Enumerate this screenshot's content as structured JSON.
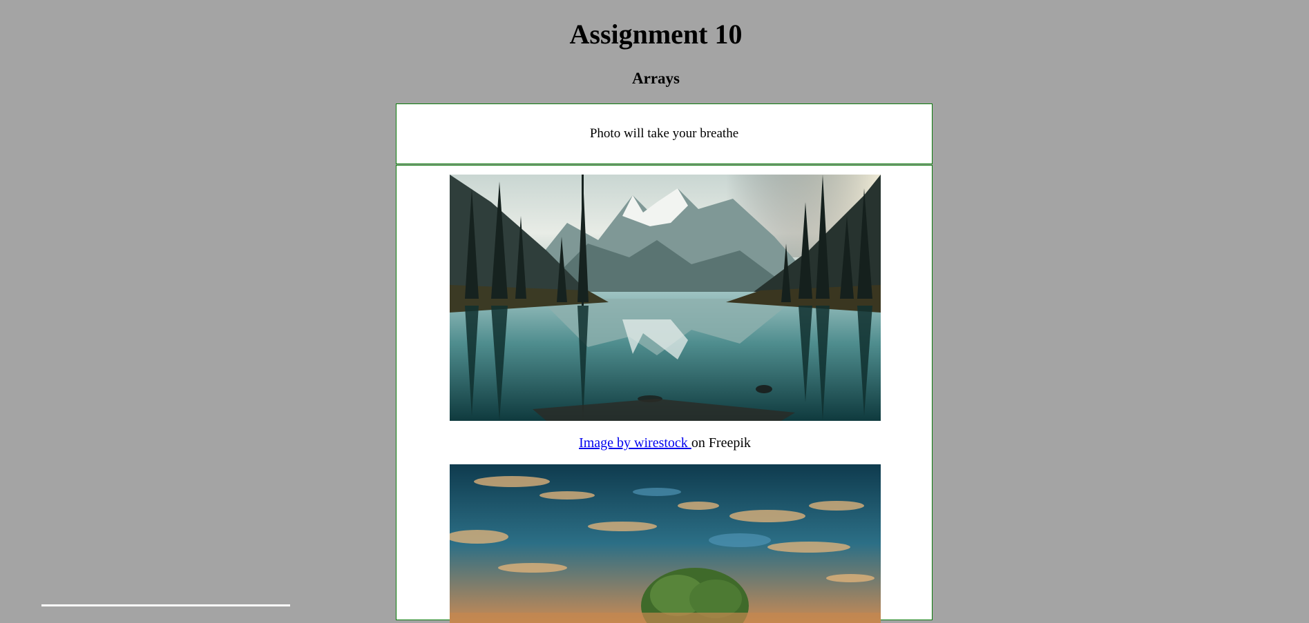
{
  "page": {
    "title": "Assignment 10",
    "subtitle": "Arrays"
  },
  "header_box": {
    "text": "Photo will take your breathe"
  },
  "gallery": {
    "items": [
      {
        "image_name": "mountain-lake-reflection-image",
        "caption_link": "Image by wirestock ",
        "caption_suffix": "on Freepik"
      },
      {
        "image_name": "sunset-tree-sky-image"
      }
    ]
  },
  "colors": {
    "background": "#a4a4a4",
    "box_border": "#0a7a0a",
    "link": "#0000ee"
  }
}
